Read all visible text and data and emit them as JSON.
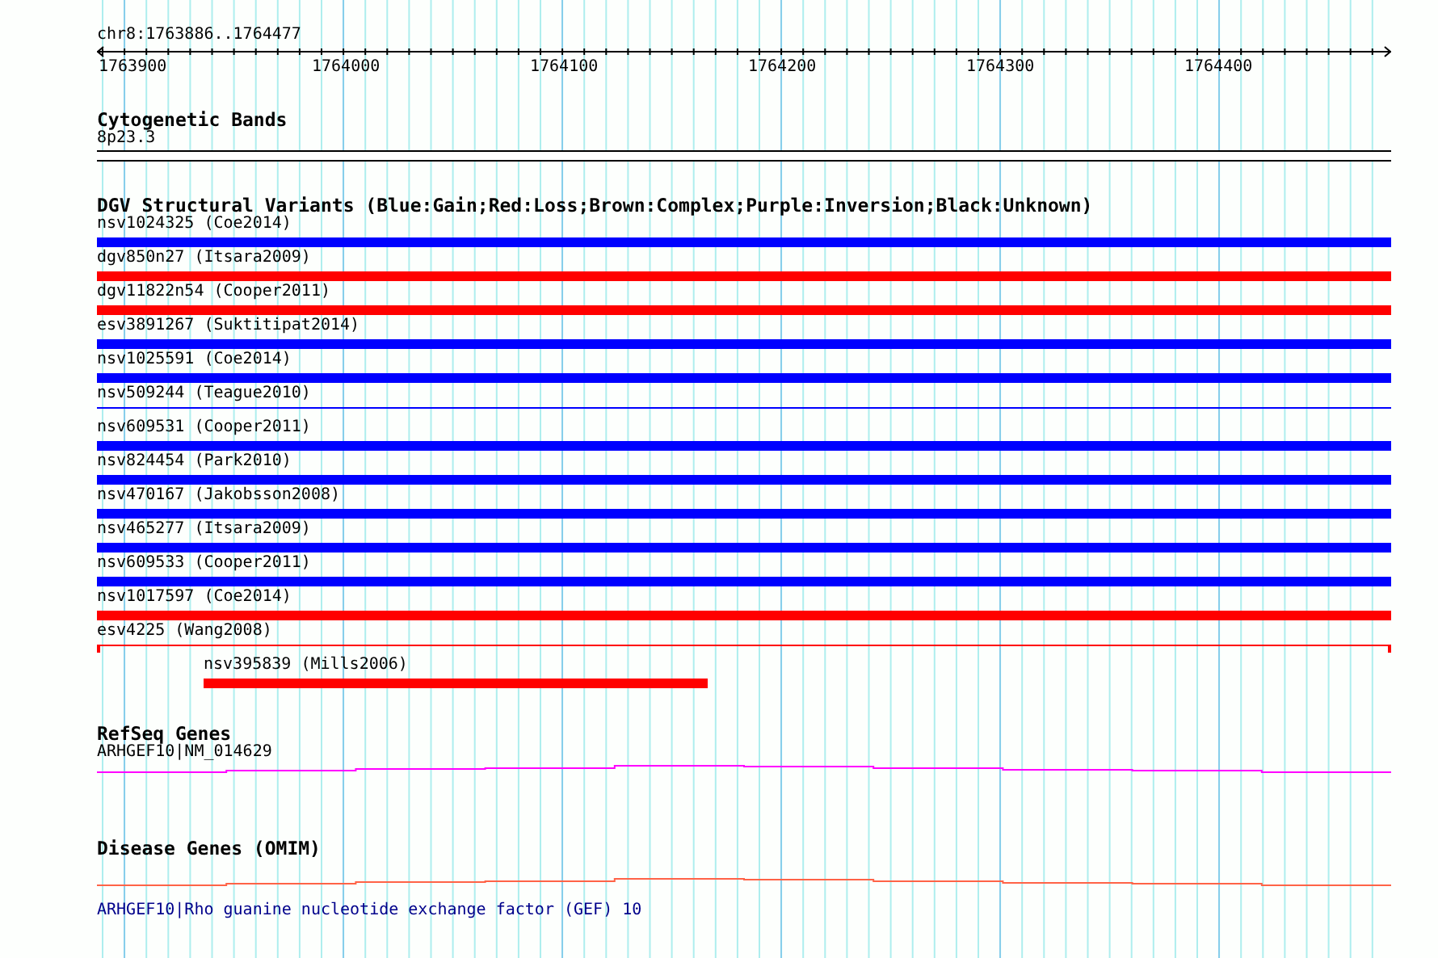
{
  "locus": "chr8:1763886..1764477",
  "ruler": {
    "ticks": [
      "1763900",
      "1764000",
      "1764100",
      "1764200",
      "1764300",
      "1764400"
    ]
  },
  "tracks": [
    {
      "kind": "cytoband",
      "title": "Cytogenetic Bands",
      "features": [
        {
          "label": "8p23.3",
          "kind": "band"
        }
      ]
    },
    {
      "kind": "variants",
      "title": "DGV Structural Variants (Blue:Gain;Red:Loss;Brown:Complex;Purple:Inversion;Black:Unknown)",
      "features": [
        {
          "label": "nsv1024325 (Coe2014)",
          "kind": "bar",
          "color": "#0000ff"
        },
        {
          "label": "dgv850n27 (Itsara2009)",
          "kind": "bar",
          "color": "#ff0000"
        },
        {
          "label": "dgv11822n54 (Cooper2011)",
          "kind": "bar",
          "color": "#ff0000"
        },
        {
          "label": "esv3891267 (Suktitipat2014)",
          "kind": "bar",
          "color": "#0000ff"
        },
        {
          "label": "nsv1025591 (Coe2014)",
          "kind": "bar",
          "color": "#0000ff"
        },
        {
          "label": "nsv509244 (Teague2010)",
          "kind": "line",
          "color": "#0000ff"
        },
        {
          "label": "nsv609531 (Cooper2011)",
          "kind": "bar",
          "color": "#0000ff"
        },
        {
          "label": "nsv824454 (Park2010)",
          "kind": "bar",
          "color": "#0000ff"
        },
        {
          "label": "nsv470167 (Jakobsson2008)",
          "kind": "bar",
          "color": "#0000ff"
        },
        {
          "label": "nsv465277 (Itsara2009)",
          "kind": "bar",
          "color": "#0000ff"
        },
        {
          "label": "nsv609533 (Cooper2011)",
          "kind": "bar",
          "color": "#0000ff"
        },
        {
          "label": "nsv1017597 (Coe2014)",
          "kind": "bar",
          "color": "#ff0000"
        },
        {
          "label": "esv4225 (Wang2008)",
          "kind": "capped-line",
          "color": "#ff0000"
        },
        {
          "label": "nsv395839 (Mills2006)",
          "kind": "inset-bar",
          "color": "#ff0000"
        }
      ]
    },
    {
      "kind": "gene",
      "title": "RefSeq Genes",
      "features": [
        {
          "label": "ARHGEF10|NM_014629",
          "color": "#ff00ff"
        }
      ]
    },
    {
      "kind": "disease",
      "title": "Disease Genes (OMIM)",
      "features": [
        {
          "label": "ARHGEF10|Rho guanine nucleotide exchange factor (GEF) 10",
          "color": "#ff6347"
        }
      ]
    }
  ]
}
